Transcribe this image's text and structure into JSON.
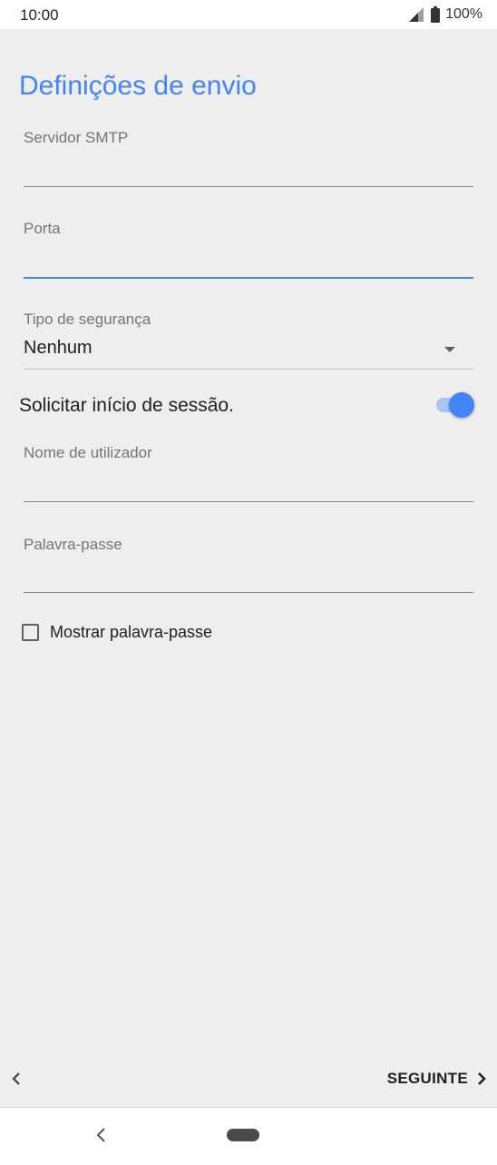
{
  "status_bar": {
    "time": "10:00",
    "battery": "100%"
  },
  "title": "Definições de envio",
  "fields": {
    "smtp_server": {
      "label": "Servidor SMTP",
      "value": ""
    },
    "port": {
      "label": "Porta",
      "value": ""
    },
    "security_type": {
      "label": "Tipo de segurança",
      "value": "Nenhum"
    },
    "username": {
      "label": "Nome de utilizador",
      "value": ""
    },
    "password": {
      "label": "Palavra-passe",
      "value": ""
    }
  },
  "require_signin": {
    "label": "Solicitar início de sessão.",
    "enabled": true
  },
  "show_password": {
    "label": "Mostrar palavra-passe",
    "checked": false
  },
  "navigation": {
    "next_label": "SEGUINTE"
  },
  "colors": {
    "accent": "#4285f4",
    "background": "#eeeeee"
  },
  "icons": {
    "signal": "signal-icon",
    "battery": "battery-icon",
    "dropdown": "dropdown-arrow-icon",
    "previous": "chevron-left-icon",
    "next": "chevron-right-icon",
    "system_back": "back-icon",
    "system_home": "home-pill-icon"
  }
}
